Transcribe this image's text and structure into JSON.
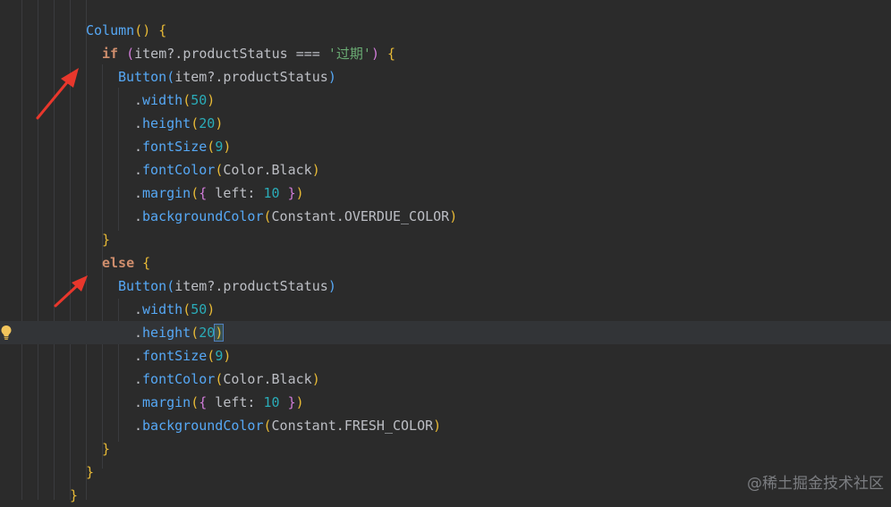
{
  "editor": {
    "lines": [
      {
        "col": 96,
        "tokens": [
          {
            "t": "Column",
            "c": "fn"
          },
          {
            "t": "()",
            "c": "paren1"
          },
          {
            "t": " ",
            "c": "punc"
          },
          {
            "t": "{",
            "c": "brace"
          }
        ]
      },
      {
        "col": 114,
        "tokens": [
          {
            "t": "if",
            "c": "kw"
          },
          {
            "t": " ",
            "c": "punc"
          },
          {
            "t": "(",
            "c": "paren2"
          },
          {
            "t": "item",
            "c": "id"
          },
          {
            "t": "?.",
            "c": "op"
          },
          {
            "t": "productStatus",
            "c": "id"
          },
          {
            "t": " === ",
            "c": "op"
          },
          {
            "t": "'过期'",
            "c": "str"
          },
          {
            "t": ")",
            "c": "paren2"
          },
          {
            "t": " ",
            "c": "punc"
          },
          {
            "t": "{",
            "c": "brace"
          }
        ]
      },
      {
        "col": 132,
        "tokens": [
          {
            "t": "Button",
            "c": "fn"
          },
          {
            "t": "(",
            "c": "paren3"
          },
          {
            "t": "item",
            "c": "id"
          },
          {
            "t": "?.",
            "c": "op"
          },
          {
            "t": "productStatus",
            "c": "id"
          },
          {
            "t": ")",
            "c": "paren3"
          }
        ]
      },
      {
        "col": 150,
        "tokens": [
          {
            "t": ".",
            "c": "op"
          },
          {
            "t": "width",
            "c": "mtd"
          },
          {
            "t": "(",
            "c": "paren1"
          },
          {
            "t": "50",
            "c": "num"
          },
          {
            "t": ")",
            "c": "paren1"
          }
        ]
      },
      {
        "col": 150,
        "tokens": [
          {
            "t": ".",
            "c": "op"
          },
          {
            "t": "height",
            "c": "mtd"
          },
          {
            "t": "(",
            "c": "paren1"
          },
          {
            "t": "20",
            "c": "num"
          },
          {
            "t": ")",
            "c": "paren1"
          }
        ]
      },
      {
        "col": 150,
        "tokens": [
          {
            "t": ".",
            "c": "op"
          },
          {
            "t": "fontSize",
            "c": "mtd"
          },
          {
            "t": "(",
            "c": "paren1"
          },
          {
            "t": "9",
            "c": "num"
          },
          {
            "t": ")",
            "c": "paren1"
          }
        ]
      },
      {
        "col": 150,
        "tokens": [
          {
            "t": ".",
            "c": "op"
          },
          {
            "t": "fontColor",
            "c": "mtd"
          },
          {
            "t": "(",
            "c": "paren1"
          },
          {
            "t": "Color",
            "c": "id"
          },
          {
            "t": ".",
            "c": "op"
          },
          {
            "t": "Black",
            "c": "id"
          },
          {
            "t": ")",
            "c": "paren1"
          }
        ]
      },
      {
        "col": 150,
        "tokens": [
          {
            "t": ".",
            "c": "op"
          },
          {
            "t": "margin",
            "c": "mtd"
          },
          {
            "t": "(",
            "c": "paren1"
          },
          {
            "t": "{",
            "c": "paren2"
          },
          {
            "t": " left: ",
            "c": "id"
          },
          {
            "t": "10",
            "c": "num"
          },
          {
            "t": " ",
            "c": "punc"
          },
          {
            "t": "}",
            "c": "paren2"
          },
          {
            "t": ")",
            "c": "paren1"
          }
        ]
      },
      {
        "col": 150,
        "tokens": [
          {
            "t": ".",
            "c": "op"
          },
          {
            "t": "backgroundColor",
            "c": "mtd"
          },
          {
            "t": "(",
            "c": "paren1"
          },
          {
            "t": "Constant",
            "c": "id"
          },
          {
            "t": ".",
            "c": "op"
          },
          {
            "t": "OVERDUE_COLOR",
            "c": "id"
          },
          {
            "t": ")",
            "c": "paren1"
          }
        ]
      },
      {
        "col": 114,
        "tokens": [
          {
            "t": "}",
            "c": "brace"
          }
        ]
      },
      {
        "col": 114,
        "tokens": [
          {
            "t": "else",
            "c": "kw"
          },
          {
            "t": " ",
            "c": "punc"
          },
          {
            "t": "{",
            "c": "brace"
          }
        ]
      },
      {
        "col": 132,
        "tokens": [
          {
            "t": "Button",
            "c": "fn"
          },
          {
            "t": "(",
            "c": "paren3"
          },
          {
            "t": "item",
            "c": "id"
          },
          {
            "t": "?.",
            "c": "op"
          },
          {
            "t": "productStatus",
            "c": "id"
          },
          {
            "t": ")",
            "c": "paren3"
          }
        ]
      },
      {
        "col": 150,
        "tokens": [
          {
            "t": ".",
            "c": "op"
          },
          {
            "t": "width",
            "c": "mtd"
          },
          {
            "t": "(",
            "c": "paren1"
          },
          {
            "t": "50",
            "c": "num"
          },
          {
            "t": ")",
            "c": "paren1"
          }
        ]
      },
      {
        "col": 150,
        "current": true,
        "tokens": [
          {
            "t": ".",
            "c": "op"
          },
          {
            "t": "height",
            "c": "mtd"
          },
          {
            "t": "(",
            "c": "paren1"
          },
          {
            "t": "20",
            "c": "num"
          },
          {
            "t": ")",
            "c": "paren1 match-paren"
          }
        ]
      },
      {
        "col": 150,
        "tokens": [
          {
            "t": ".",
            "c": "op"
          },
          {
            "t": "fontSize",
            "c": "mtd"
          },
          {
            "t": "(",
            "c": "paren1"
          },
          {
            "t": "9",
            "c": "num"
          },
          {
            "t": ")",
            "c": "paren1"
          }
        ]
      },
      {
        "col": 150,
        "tokens": [
          {
            "t": ".",
            "c": "op"
          },
          {
            "t": "fontColor",
            "c": "mtd"
          },
          {
            "t": "(",
            "c": "paren1"
          },
          {
            "t": "Color",
            "c": "id"
          },
          {
            "t": ".",
            "c": "op"
          },
          {
            "t": "Black",
            "c": "id"
          },
          {
            "t": ")",
            "c": "paren1"
          }
        ]
      },
      {
        "col": 150,
        "tokens": [
          {
            "t": ".",
            "c": "op"
          },
          {
            "t": "margin",
            "c": "mtd"
          },
          {
            "t": "(",
            "c": "paren1"
          },
          {
            "t": "{",
            "c": "paren2"
          },
          {
            "t": " left: ",
            "c": "id"
          },
          {
            "t": "10",
            "c": "num"
          },
          {
            "t": " ",
            "c": "punc"
          },
          {
            "t": "}",
            "c": "paren2"
          },
          {
            "t": ")",
            "c": "paren1"
          }
        ]
      },
      {
        "col": 150,
        "tokens": [
          {
            "t": ".",
            "c": "op"
          },
          {
            "t": "backgroundColor",
            "c": "mtd"
          },
          {
            "t": "(",
            "c": "paren1"
          },
          {
            "t": "Constant",
            "c": "id"
          },
          {
            "t": ".",
            "c": "op"
          },
          {
            "t": "FRESH_COLOR",
            "c": "id"
          },
          {
            "t": ")",
            "c": "paren1"
          }
        ]
      },
      {
        "col": 114,
        "tokens": [
          {
            "t": "}",
            "c": "brace"
          }
        ]
      },
      {
        "col": 96,
        "tokens": [
          {
            "t": "}",
            "c": "brace"
          }
        ]
      },
      {
        "col": 78,
        "tokens": [
          {
            "t": "}",
            "c": "brace"
          }
        ]
      }
    ]
  },
  "icons": {
    "intention_bulb": "lightbulb-icon",
    "annotation": "red-arrow-icon"
  },
  "colors": {
    "background": "#2b2b2b",
    "current_line": "#323437",
    "arrow": "#e8372c"
  },
  "watermark": {
    "text": "@稀土掘金技术社区"
  }
}
